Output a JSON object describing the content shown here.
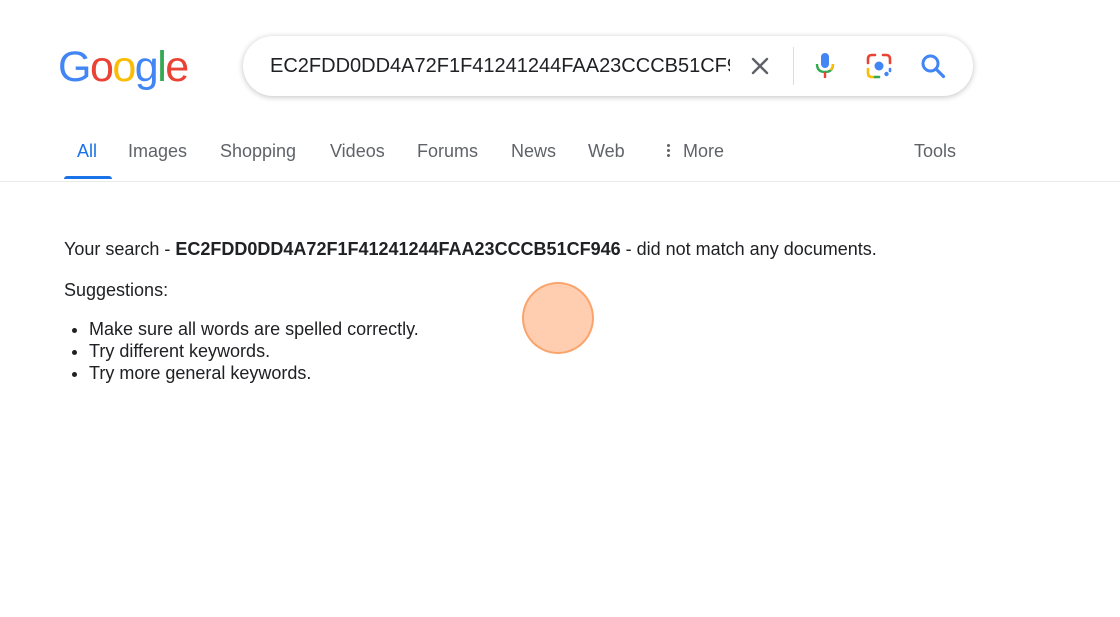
{
  "logo": {
    "letters": [
      "G",
      "o",
      "o",
      "g",
      "l",
      "e"
    ],
    "colors": [
      "#4285F4",
      "#EA4335",
      "#FBBC05",
      "#4285F4",
      "#34A853",
      "#EA4335"
    ]
  },
  "search": {
    "query": "EC2FDD0DD4A72F1F41241244FAA23CCCB51CF946",
    "clear_icon": "close-icon",
    "voice_icon": "microphone-icon",
    "lens_icon": "camera-lens-icon",
    "submit_icon": "search-icon"
  },
  "tabs": {
    "items": [
      "All",
      "Images",
      "Shopping",
      "Videos",
      "Forums",
      "News",
      "Web"
    ],
    "more_label": "More",
    "tools_label": "Tools",
    "active": "All",
    "active_color": "#1a73e8"
  },
  "results": {
    "prefix": "Your search - ",
    "query": "EC2FDD0DD4A72F1F41241244FAA23CCCB51CF946",
    "suffix": " - did not match any documents.",
    "suggestions_heading": "Suggestions:",
    "suggestions": [
      "Make sure all words are spelled correctly.",
      "Try different keywords.",
      "Try more general keywords."
    ]
  }
}
